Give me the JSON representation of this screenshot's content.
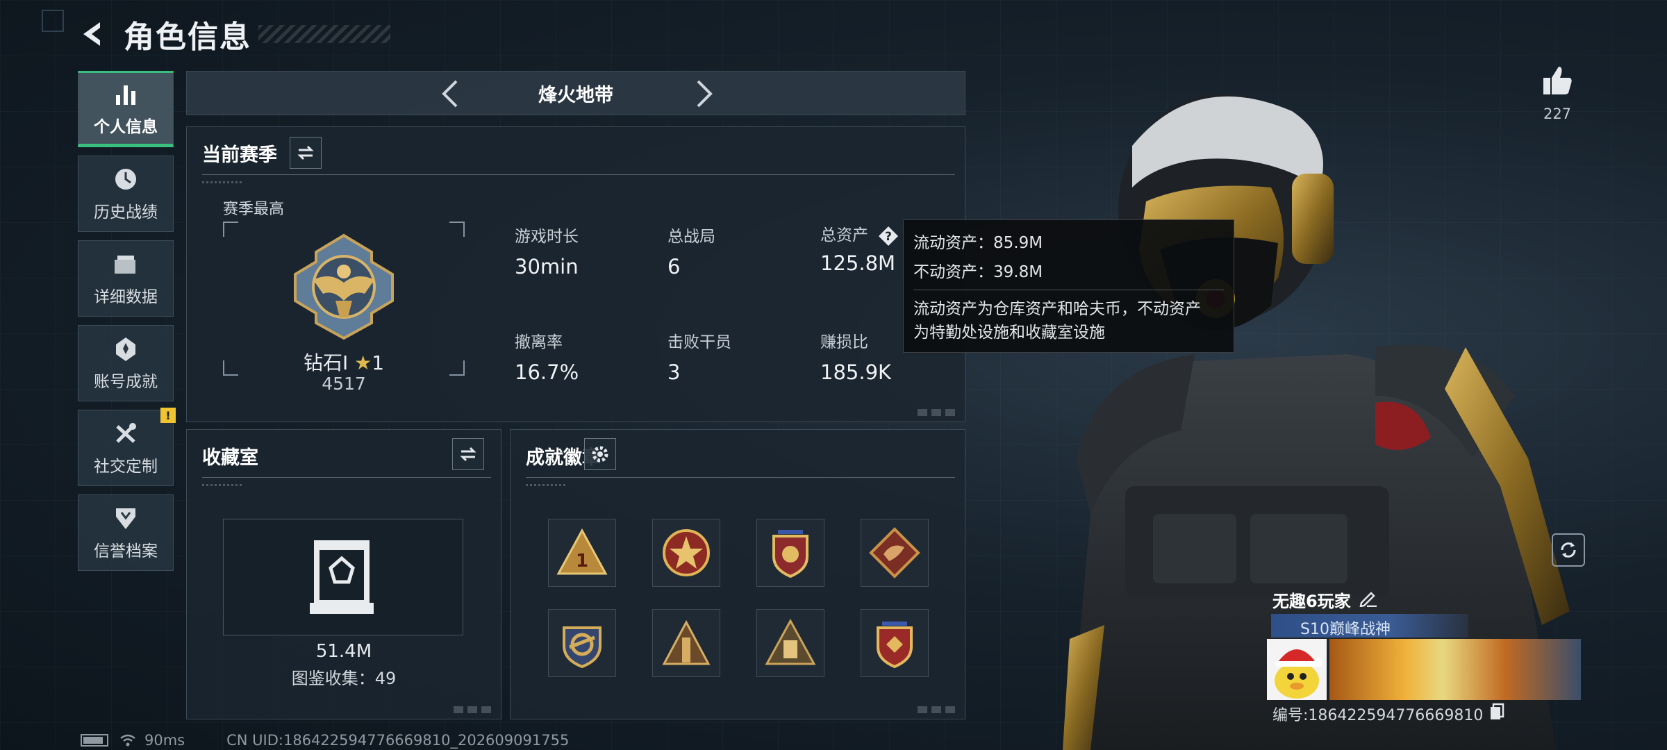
{
  "header": {
    "title": "角色信息"
  },
  "sidebar": {
    "items": [
      {
        "label": "个人信息",
        "icon": "bar-chart-icon",
        "active": true
      },
      {
        "label": "历史战绩",
        "icon": "clock-icon"
      },
      {
        "label": "详细数据",
        "icon": "folder-icon"
      },
      {
        "label": "账号成就",
        "icon": "medal-icon"
      },
      {
        "label": "社交定制",
        "icon": "tools-icon",
        "badge": "!"
      },
      {
        "label": "信誉档案",
        "icon": "shield-icon"
      }
    ]
  },
  "mode": {
    "label": "烽火地带"
  },
  "season": {
    "title": "当前赛季",
    "best_label": "赛季最高",
    "rank_name": "钻石I",
    "rank_stars": "1",
    "rank_score": "4517",
    "stats": [
      {
        "label": "游戏时长",
        "value": "30min"
      },
      {
        "label": "总战局",
        "value": "6"
      },
      {
        "label": "总资产",
        "value": "125.8M"
      },
      {
        "label": "撤离率",
        "value": "16.7%"
      },
      {
        "label": "击败干员",
        "value": "3"
      },
      {
        "label": "赚损比",
        "value": "185.9K"
      }
    ]
  },
  "tooltip": {
    "liquid": "流动资产：85.9M",
    "fixed": "不动资产：39.8M",
    "note_line1": "流动资产为仓库资产和哈夫币，不动资产",
    "note_line2": "为特勤处设施和收藏室设施"
  },
  "collection": {
    "title": "收藏室",
    "value": "51.4M",
    "count": "图鉴收集：49"
  },
  "badges": {
    "title": "成就徽章"
  },
  "likes": {
    "count": "227"
  },
  "player": {
    "name": "无趣6玩家",
    "rank_tag": "S10巅峰战神",
    "id": "编号:186422594776669810"
  },
  "status_bar": {
    "ping": "90ms",
    "uid": "CN UID:186422594776669810_202609091755"
  },
  "colors": {
    "accent": "#39c07f",
    "warning": "#f0c330",
    "panel": "#1b2630"
  }
}
